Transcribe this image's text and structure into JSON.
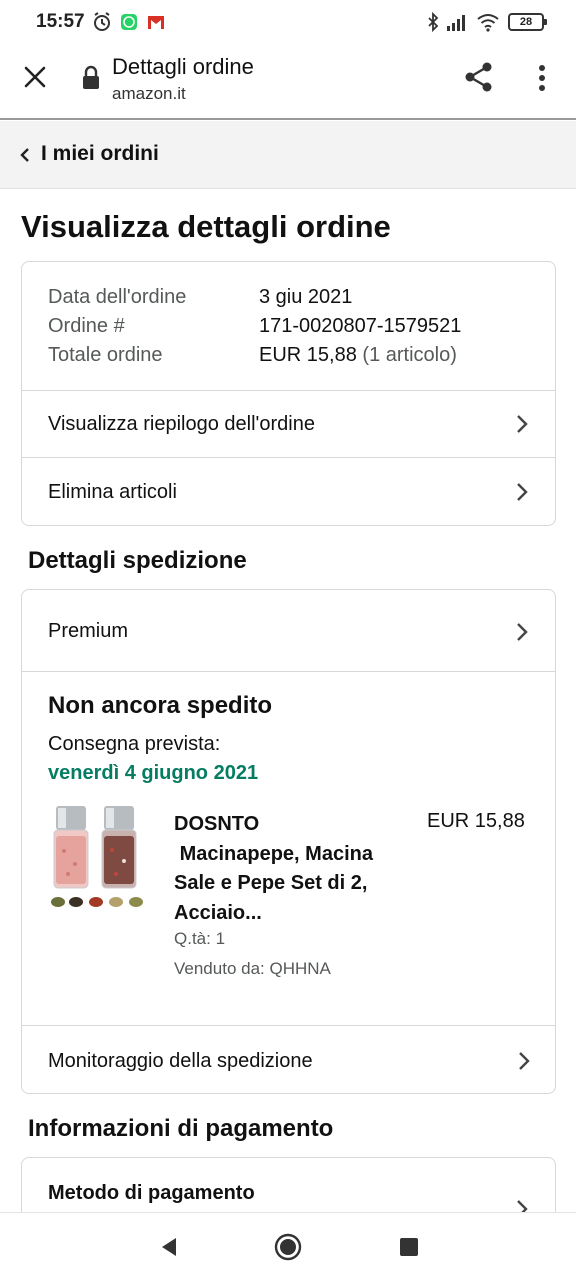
{
  "status_bar": {
    "time": "15:57",
    "battery": "28",
    "icons": [
      "alarm-icon",
      "whatsapp-icon",
      "gmail-icon",
      "bluetooth-icon",
      "signal-icon",
      "wifi-icon"
    ]
  },
  "browser": {
    "title": "Dettagli ordine",
    "url": "amazon.it"
  },
  "back": {
    "label": "I miei ordini"
  },
  "page_title": "Visualizza dettagli ordine",
  "order_summary": {
    "date_label": "Data dell'ordine",
    "date_value": "3 giu 2021",
    "number_label": "Ordine #",
    "number_value": "171-0020807-1579521",
    "total_label": "Totale ordine",
    "total_value": "EUR 15,88",
    "total_items": "(1 articolo)",
    "view_summary": "Visualizza riepilogo dell'ordine",
    "delete_items": "Elimina articoli"
  },
  "shipping": {
    "section_title": "Dettagli spedizione",
    "method": "Premium",
    "status": "Non ancora spedito",
    "delivery_label": "Consegna prevista:",
    "delivery_date": "venerdì 4 giugno 2021",
    "product": {
      "title": "DOSNTO\n Macinapepe, Macina Sale e Pepe Set di 2, Acciaio...",
      "price": "EUR 15,88",
      "qty": "Q.tà: 1",
      "seller": "Venduto da: QHHNA"
    },
    "tracking": "Monitoraggio della spedizione"
  },
  "payment": {
    "section_title": "Informazioni di pagamento",
    "method_label": "Metodo di pagamento"
  },
  "colors": {
    "delivery_green": "#067d62",
    "muted_text": "#565959",
    "card_border": "#d5d9d9",
    "back_bar_bg": "#f3f3f3"
  }
}
